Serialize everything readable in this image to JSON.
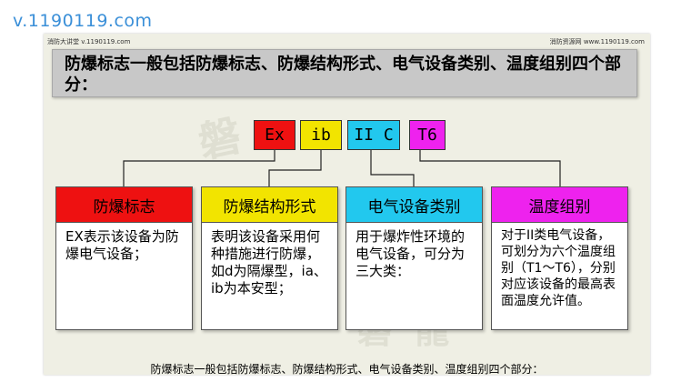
{
  "watermark_url": "v.1190119.com",
  "slide": {
    "header_left": "消防大讲堂 v.1190119.com",
    "header_right": "消防资源网 www.1190119.com",
    "title": "防爆标志一般包括防爆标志、防爆结构形式、电气设备类别、温度组别四个部分：",
    "seal_text_1": "磐",
    "seal_text_2": "磐 龍",
    "codes": {
      "ex": "Ex",
      "ib": "ib",
      "iic": "II C",
      "t6": "T6"
    },
    "columns": [
      {
        "head": "防爆标志",
        "body": "EX表示该设备为防爆电气设备；"
      },
      {
        "head": "防爆结构形式",
        "body": "表明该设备采用何种措施进行防爆，如d为隔爆型，ia、ib为本安型；"
      },
      {
        "head": "电气设备类别",
        "body": "用于爆炸性环境的电气设备，可分为三大类："
      },
      {
        "head": "温度组别",
        "body": "对于II类电气设备，可划分为六个温度组别（T1～T6），分别对应该设备的最高表面温度允许值。"
      }
    ],
    "caption": "防爆标志一般包括防爆标志、防爆结构形式、电气设备类别、温度组别四个部分："
  },
  "colors": {
    "red": "#ee1111",
    "yellow": "#f2e400",
    "cyan": "#22c8ee",
    "magenta": "#ee22ee"
  }
}
